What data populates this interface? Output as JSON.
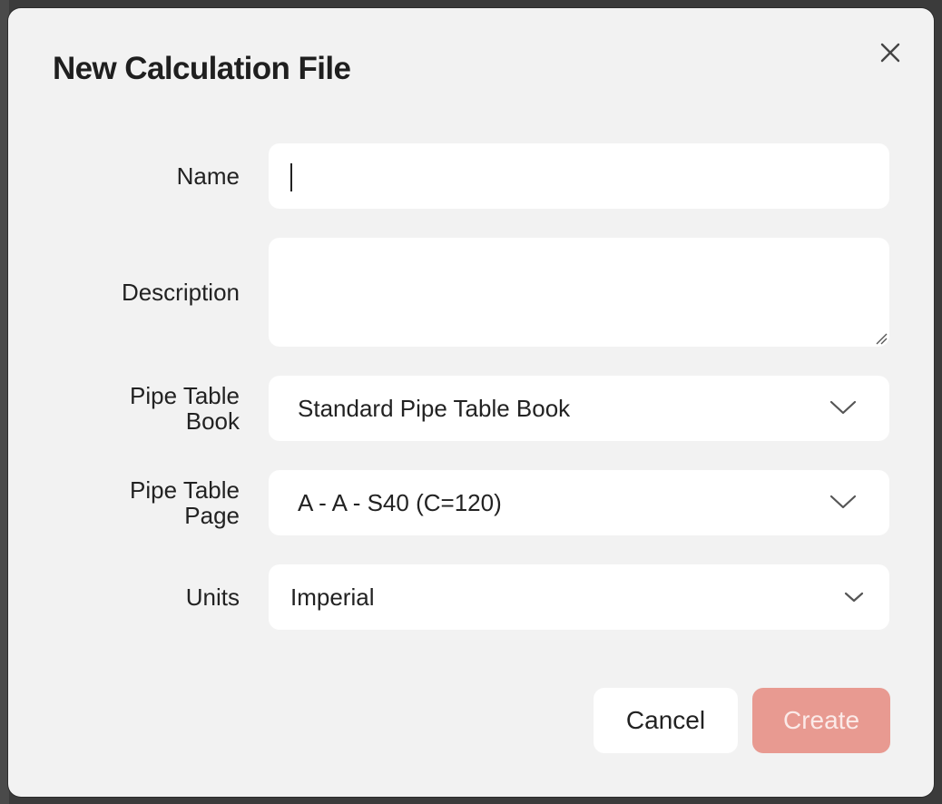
{
  "dialog": {
    "title": "New Calculation File"
  },
  "fields": {
    "name": {
      "label": "Name",
      "value": ""
    },
    "description": {
      "label": "Description",
      "value": ""
    },
    "pipe_table_book": {
      "label_line1": "Pipe Table",
      "label_line2": "Book",
      "selected": "Standard Pipe Table Book"
    },
    "pipe_table_page": {
      "label_line1": "Pipe Table",
      "label_line2": "Page",
      "selected": "A - A - S40 (C=120)"
    },
    "units": {
      "label": "Units",
      "selected": "Imperial"
    }
  },
  "buttons": {
    "cancel": "Cancel",
    "create": "Create"
  },
  "icons": {
    "close": "close-icon",
    "chevron": "chevron-down-icon"
  },
  "colors": {
    "create_button": "#e89a91",
    "modal_background": "#f2f2f2"
  }
}
